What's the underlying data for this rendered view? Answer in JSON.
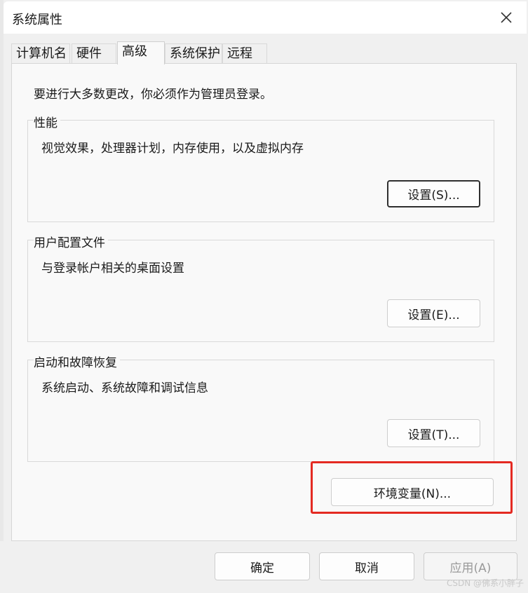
{
  "window": {
    "title": "系统属性",
    "close_icon": "close-icon"
  },
  "tabs": [
    {
      "label": "计算机名",
      "active": false
    },
    {
      "label": "硬件",
      "active": false
    },
    {
      "label": "高级",
      "active": true
    },
    {
      "label": "系统保护",
      "active": false
    },
    {
      "label": "远程",
      "active": false
    }
  ],
  "advanced": {
    "notice": "要进行大多数更改，你必须作为管理员登录。",
    "performance": {
      "title": "性能",
      "description": "视觉效果，处理器计划，内存使用，以及虚拟内存",
      "button_label": "设置(S)..."
    },
    "user_profiles": {
      "title": "用户配置文件",
      "description": "与登录帐户相关的桌面设置",
      "button_label": "设置(E)..."
    },
    "startup_recovery": {
      "title": "启动和故障恢复",
      "description": "系统启动、系统故障和调试信息",
      "button_label": "设置(T)..."
    },
    "env_vars_button_label": "环境变量(N)...",
    "highlight_color": "#e42a22"
  },
  "footer": {
    "ok_label": "确定",
    "cancel_label": "取消",
    "apply_label": "应用(A)"
  },
  "watermark": "CSDN @佛系小胖子"
}
